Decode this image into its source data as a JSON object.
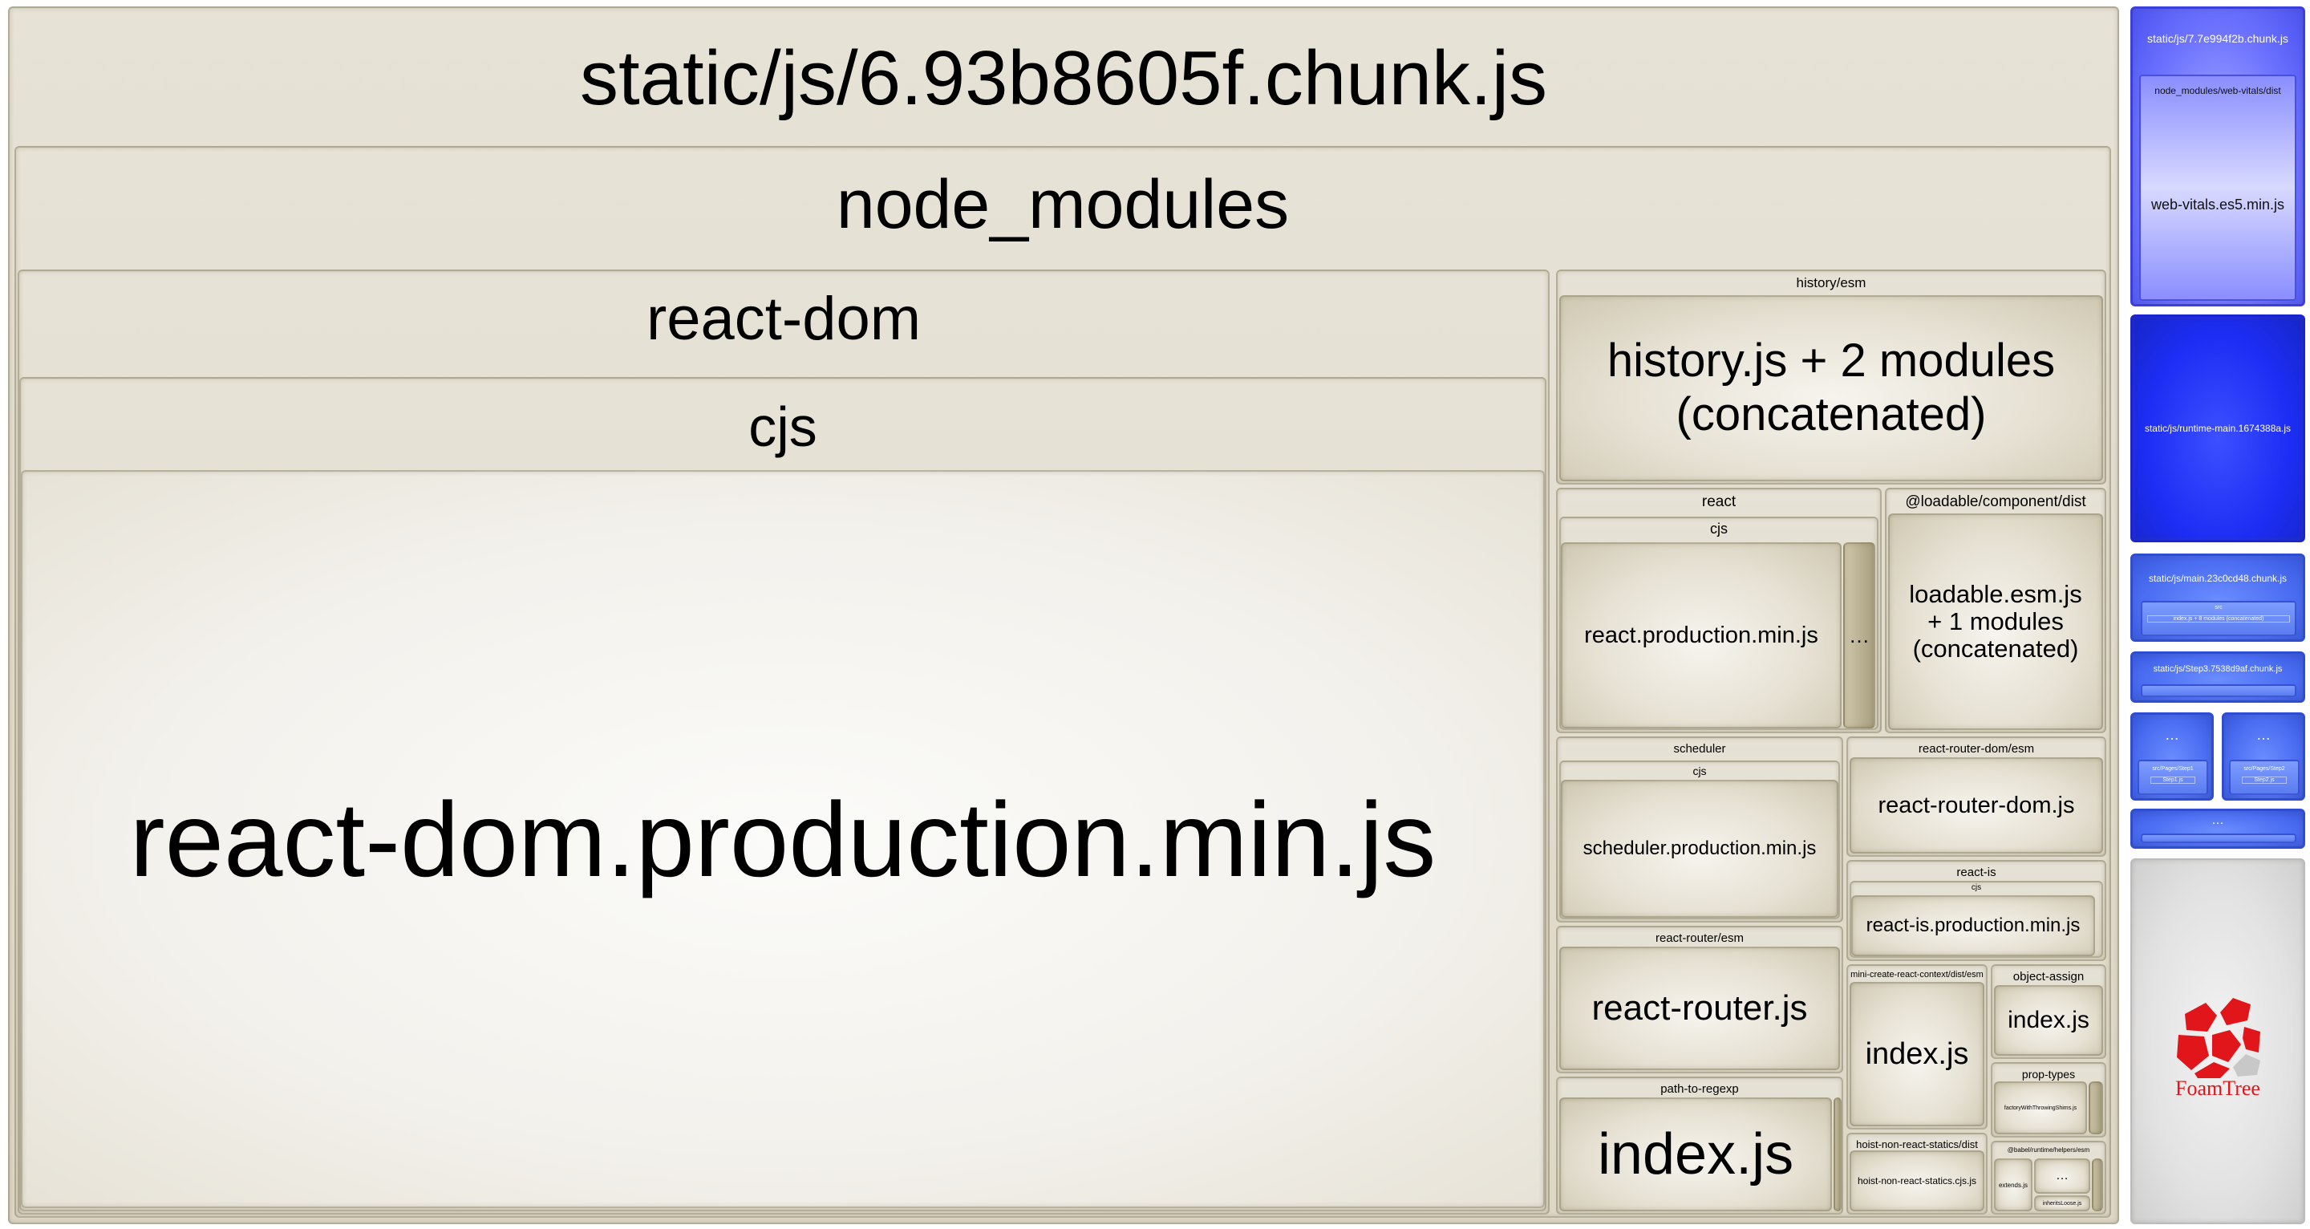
{
  "toggle": {
    "icon": "›"
  },
  "chunk": {
    "title": "static/js/6.93b8605f.chunk.js",
    "node_modules": "node_modules",
    "react_dom": "react-dom",
    "react_dom_cjs": "cjs",
    "react_dom_file": "react-dom.production.min.js",
    "history_dir": "history/esm",
    "history_file": "history.js + 2 modules (concatenated)",
    "react_dir": "react",
    "react_cjs": "cjs",
    "react_file": "react.production.min.js",
    "react_more": "…",
    "loadable_dir": "@loadable/component/dist",
    "loadable_file": "loadable.esm.js + 1 modules (concatenated)",
    "scheduler_dir": "scheduler",
    "scheduler_cjs": "cjs",
    "scheduler_file": "scheduler.production.min.js",
    "rrdom_dir": "react-router-dom/esm",
    "rrdom_file": "react-router-dom.js",
    "react_is_dir": "react-is",
    "react_is_cjs": "cjs",
    "react_is_file": "react-is.production.min.js",
    "rrouter_dir": "react-router/esm",
    "rrouter_file": "react-router.js",
    "mcrc_dir": "mini-create-react-context/dist/esm",
    "mcrc_file": "index.js",
    "obj_assign_dir": "object-assign",
    "obj_assign_file": "index.js",
    "prop_types_dir": "prop-types",
    "prop_types_file": "factoryWithThrowingShims.js",
    "ptre_dir": "path-to-regexp",
    "ptre_file": "index.js",
    "hnrs_dir": "hoist-non-react-statics/dist",
    "hnrs_file": "hoist-non-react-statics.cjs.js",
    "babel_dir": "@babel/runtime/helpers/esm",
    "babel_file_a": "extends.js",
    "babel_more": "…",
    "babel_file_b": "inheritsLoose.js"
  },
  "side": {
    "c7_title": "static/js/7.7e994f2b.chunk.js",
    "c7_dir": "node_modules/web-vitals/dist",
    "c7_file": "web-vitals.es5.min.js",
    "runtime": "static/js/runtime-main.1674388a.js",
    "main_title": "static/js/main.23c0cd48.chunk.js",
    "main_src": "src",
    "main_file": "index.js + 8 modules (concatenated)",
    "step3_title": "static/js/Step3.7538d9af.chunk.js",
    "step1_more": "…",
    "step1_dir": "src/Pages/Step1",
    "step1_file": "Step1.js",
    "step2_more": "…",
    "step2_dir": "src/Pages/Step2",
    "step2_file": "Step2.js",
    "more": "…",
    "logo": "FoamTree"
  }
}
